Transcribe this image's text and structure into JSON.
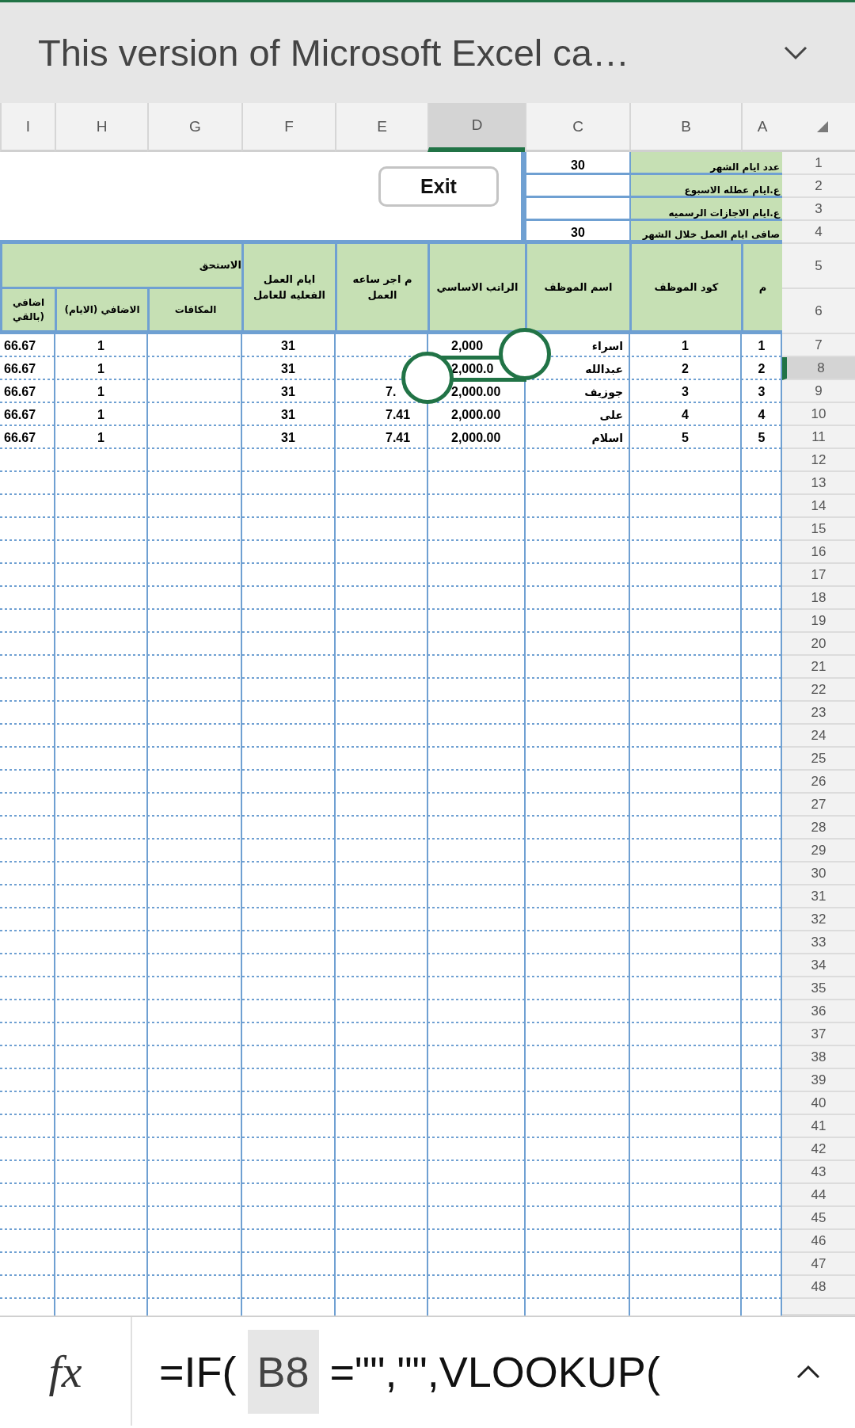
{
  "banner": {
    "title": "This version of Microsoft Excel ca…"
  },
  "sheet": {
    "columns": [
      {
        "label": "A",
        "selected": false
      },
      {
        "label": "B",
        "selected": false
      },
      {
        "label": "C",
        "selected": false
      },
      {
        "label": "D",
        "selected": true
      },
      {
        "label": "E",
        "selected": false
      },
      {
        "label": "F",
        "selected": false
      },
      {
        "label": "G",
        "selected": false
      },
      {
        "label": "H",
        "selected": false
      },
      {
        "label": "I",
        "selected": false
      }
    ],
    "row_numbers": [
      {
        "label": "1",
        "selected": false
      },
      {
        "label": "2",
        "selected": false
      },
      {
        "label": "3",
        "selected": false
      },
      {
        "label": "4",
        "selected": false
      },
      {
        "label": "5",
        "selected": false
      },
      {
        "label": "6",
        "selected": false
      },
      {
        "label": "7",
        "selected": false
      },
      {
        "label": "8",
        "selected": true
      },
      {
        "label": "9",
        "selected": false
      },
      {
        "label": "10",
        "selected": false
      },
      {
        "label": "11",
        "selected": false
      },
      {
        "label": "12",
        "selected": false
      },
      {
        "label": "13",
        "selected": false
      },
      {
        "label": "14",
        "selected": false
      },
      {
        "label": "15",
        "selected": false
      },
      {
        "label": "16",
        "selected": false
      },
      {
        "label": "17",
        "selected": false
      },
      {
        "label": "18",
        "selected": false
      },
      {
        "label": "19",
        "selected": false
      },
      {
        "label": "20",
        "selected": false
      },
      {
        "label": "21",
        "selected": false
      },
      {
        "label": "22",
        "selected": false
      },
      {
        "label": "23",
        "selected": false
      },
      {
        "label": "24",
        "selected": false
      },
      {
        "label": "25",
        "selected": false
      },
      {
        "label": "26",
        "selected": false
      },
      {
        "label": "27",
        "selected": false
      },
      {
        "label": "28",
        "selected": false
      },
      {
        "label": "29",
        "selected": false
      },
      {
        "label": "30",
        "selected": false
      },
      {
        "label": "31",
        "selected": false
      },
      {
        "label": "32",
        "selected": false
      },
      {
        "label": "33",
        "selected": false
      },
      {
        "label": "34",
        "selected": false
      },
      {
        "label": "35",
        "selected": false
      },
      {
        "label": "36",
        "selected": false
      },
      {
        "label": "37",
        "selected": false
      },
      {
        "label": "38",
        "selected": false
      },
      {
        "label": "39",
        "selected": false
      },
      {
        "label": "40",
        "selected": false
      },
      {
        "label": "41",
        "selected": false
      },
      {
        "label": "42",
        "selected": false
      },
      {
        "label": "43",
        "selected": false
      },
      {
        "label": "44",
        "selected": false
      },
      {
        "label": "45",
        "selected": false
      },
      {
        "label": "46",
        "selected": false
      },
      {
        "label": "47",
        "selected": false
      },
      {
        "label": "48",
        "selected": false
      }
    ],
    "parameters": [
      {
        "label": "عدد ايام الشهر",
        "value": "30"
      },
      {
        "label": "ع.ايام عطله الاسبوع"
      },
      {
        "label": "ع.ايام الاجازات الرسميه"
      },
      {
        "label": "صافى ايام العمل خلال الشهر",
        "value": "30"
      }
    ],
    "exit_button": "Exit",
    "table": {
      "headers": [
        "م",
        "كود الموظف",
        "اسم الموظف",
        "الراتب الاساسي",
        "م اجر ساعه العمل",
        "ايام العمل الفعليه للعامل"
      ],
      "group_header": "الاستحق",
      "sub_headers": [
        "المكافات",
        "الاضافي (الايام)",
        "اضافي (بالقي"
      ],
      "rows": [
        {
          "no": "1",
          "code": "1",
          "name": "اسراء",
          "salary": "2,000",
          "days": "31",
          "extra_days": "1",
          "extra_value": "66.67"
        },
        {
          "no": "2",
          "code": "2",
          "name": "عبدالله",
          "salary": "2,000.0",
          "days": "31",
          "extra_days": "1",
          "extra_value": "66.67"
        },
        {
          "no": "3",
          "code": "3",
          "name": "جوزيف",
          "salary": "2,000.00",
          "hourly": "7.",
          "days": "31",
          "extra_days": "1",
          "extra_value": "66.67"
        },
        {
          "no": "4",
          "code": "4",
          "name": "على",
          "salary": "2,000.00",
          "hourly": "7.41",
          "days": "31",
          "extra_days": "1",
          "extra_value": "66.67"
        },
        {
          "no": "5",
          "code": "5",
          "name": "اسلام",
          "salary": "2,000.00",
          "hourly": "7.41",
          "days": "31",
          "extra_days": "1",
          "extra_value": "66.67"
        }
      ]
    }
  },
  "formula_bar": {
    "function_label": "fx",
    "text_before": "=IF(",
    "reference": "B8",
    "text_after": "=\"\",\"\",VLOOKUP("
  }
}
